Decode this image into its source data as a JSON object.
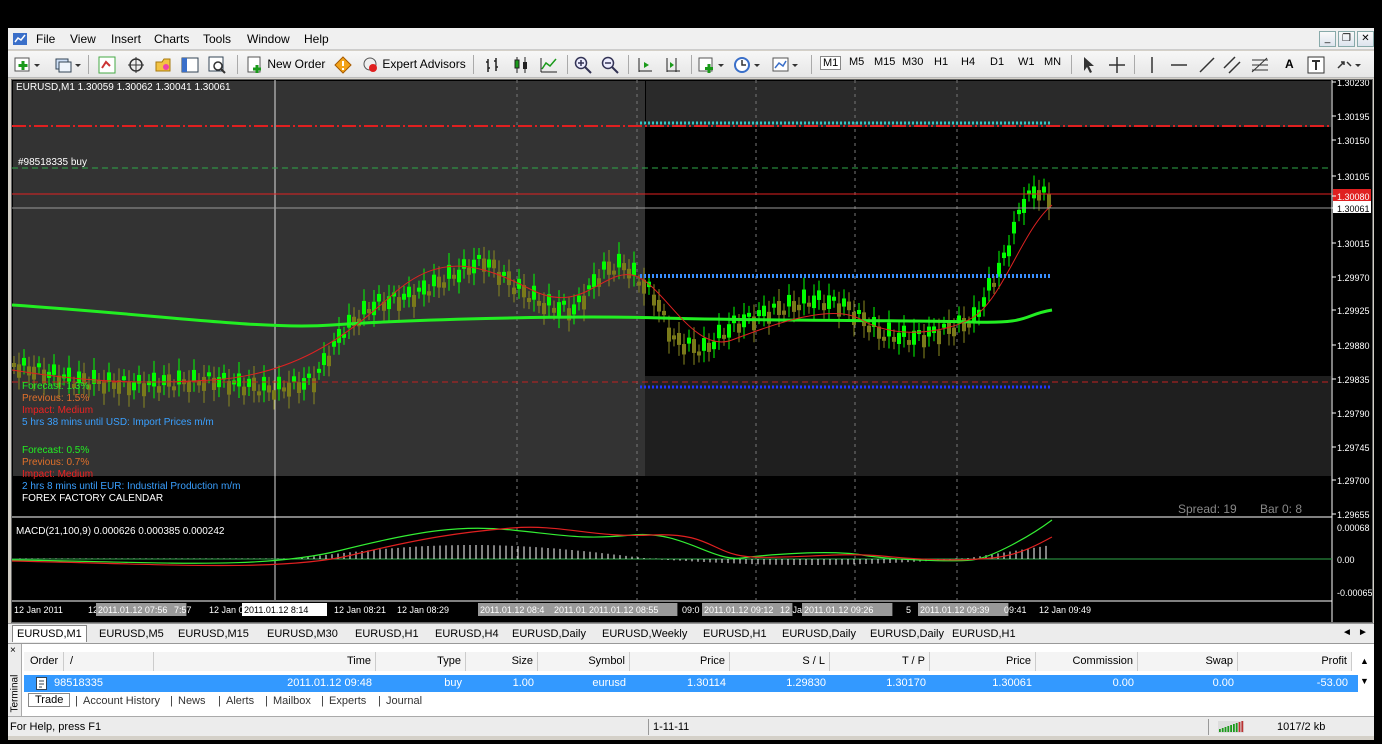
{
  "menu": [
    "File",
    "View",
    "Insert",
    "Charts",
    "Tools",
    "Window",
    "Help"
  ],
  "toolbar": {
    "new_order": "New Order",
    "expert_advisors": "Expert Advisors",
    "timeframes": [
      "M1",
      "M5",
      "M15",
      "M30",
      "H1",
      "H4",
      "D1",
      "W1",
      "MN"
    ]
  },
  "chart": {
    "header": "EURUSD,M1  1.30059 1.30062 1.30041 1.30061",
    "order_label": "#98518335 buy",
    "price_ticks": [
      "1.30230",
      "1.30195",
      "1.30150",
      "1.30105",
      "1.30080",
      "1.30061",
      "1.30015",
      "1.29970",
      "1.29925",
      "1.29880",
      "1.29835",
      "1.29790",
      "1.29745",
      "1.29700",
      "1.29655"
    ],
    "spread": "Spread: 19",
    "bar": "Bar  0:  8",
    "macd_header": "MACD(21,100,9) 0.000626 0.000385 0.000242",
    "macd_ticks": [
      "0.00068",
      "0.00",
      "-0.00065"
    ],
    "time_labels": [
      "12 Jan 2011",
      "12 J",
      "2011.01.12 07:56",
      "7:57",
      "12 Jan 0",
      "2011.01.12 8:14",
      "12 Jan 08:21",
      "12 Jan 08:29",
      "2011.01.12 08:4",
      "2011.01.1",
      "2011.01.12 08:55",
      "09:0",
      "2011.01.12 09:12",
      "12 Jan 0",
      "2011.01.12 09:26",
      "5",
      "2011.01.12 09:39",
      "09:41",
      "12 Jan 09:49"
    ],
    "news": [
      {
        "text": "Forecast: 1.3%",
        "color": "#22ee22"
      },
      {
        "text": "Previous: 1.5%",
        "color": "#e0702a"
      },
      {
        "text": "Impact: Medium",
        "color": "#ee2222"
      },
      {
        "text": "5 hrs 38 mins until USD: Import Prices m/m",
        "color": "#3aa0ff"
      },
      {
        "text": "Forecast: 0.5%",
        "color": "#22ee22"
      },
      {
        "text": "Previous: 0.7%",
        "color": "#e0702a"
      },
      {
        "text": "Impact: Medium",
        "color": "#ee2222"
      },
      {
        "text": "2 hrs 8 mins until EUR: Industrial Production m/m",
        "color": "#3aa0ff"
      },
      {
        "text": "FOREX FACTORY CALENDAR",
        "color": "#ffffff"
      }
    ]
  },
  "chart_tabs": [
    "EURUSD,M1",
    "EURUSD,M5",
    "EURUSD,M15",
    "EURUSD,M30",
    "EURUSD,H1",
    "EURUSD,H4",
    "EURUSD,Daily",
    "EURUSD,Weekly",
    "EURUSD,H1",
    "EURUSD,Daily",
    "EURUSD,Daily",
    "EURUSD,H1"
  ],
  "terminal": {
    "side_label": "Terminal",
    "columns": [
      "Order",
      "/",
      "Time",
      "Type",
      "Size",
      "Symbol",
      "Price",
      "S / L",
      "T / P",
      "Price",
      "Commission",
      "Swap",
      "Profit"
    ],
    "row": [
      "98518335",
      "2011.01.12 09:48",
      "buy",
      "1.00",
      "eurusd",
      "1.30114",
      "1.29830",
      "1.30170",
      "1.30061",
      "0.00",
      "0.00",
      "-53.00"
    ],
    "tabs": [
      "Trade",
      "Account History",
      "News",
      "Alerts",
      "Mailbox",
      "Experts",
      "Journal"
    ]
  },
  "status": {
    "help": "For Help, press F1",
    "profile": "1-11-11",
    "traffic": "1017/2 kb"
  },
  "colors": {
    "bull_candle": "#00ff00",
    "bear_candle": "#7a7a1a",
    "ma_line": "#22ee22",
    "stop_line": "#e02020",
    "bid_line": "#aaaaaa"
  }
}
